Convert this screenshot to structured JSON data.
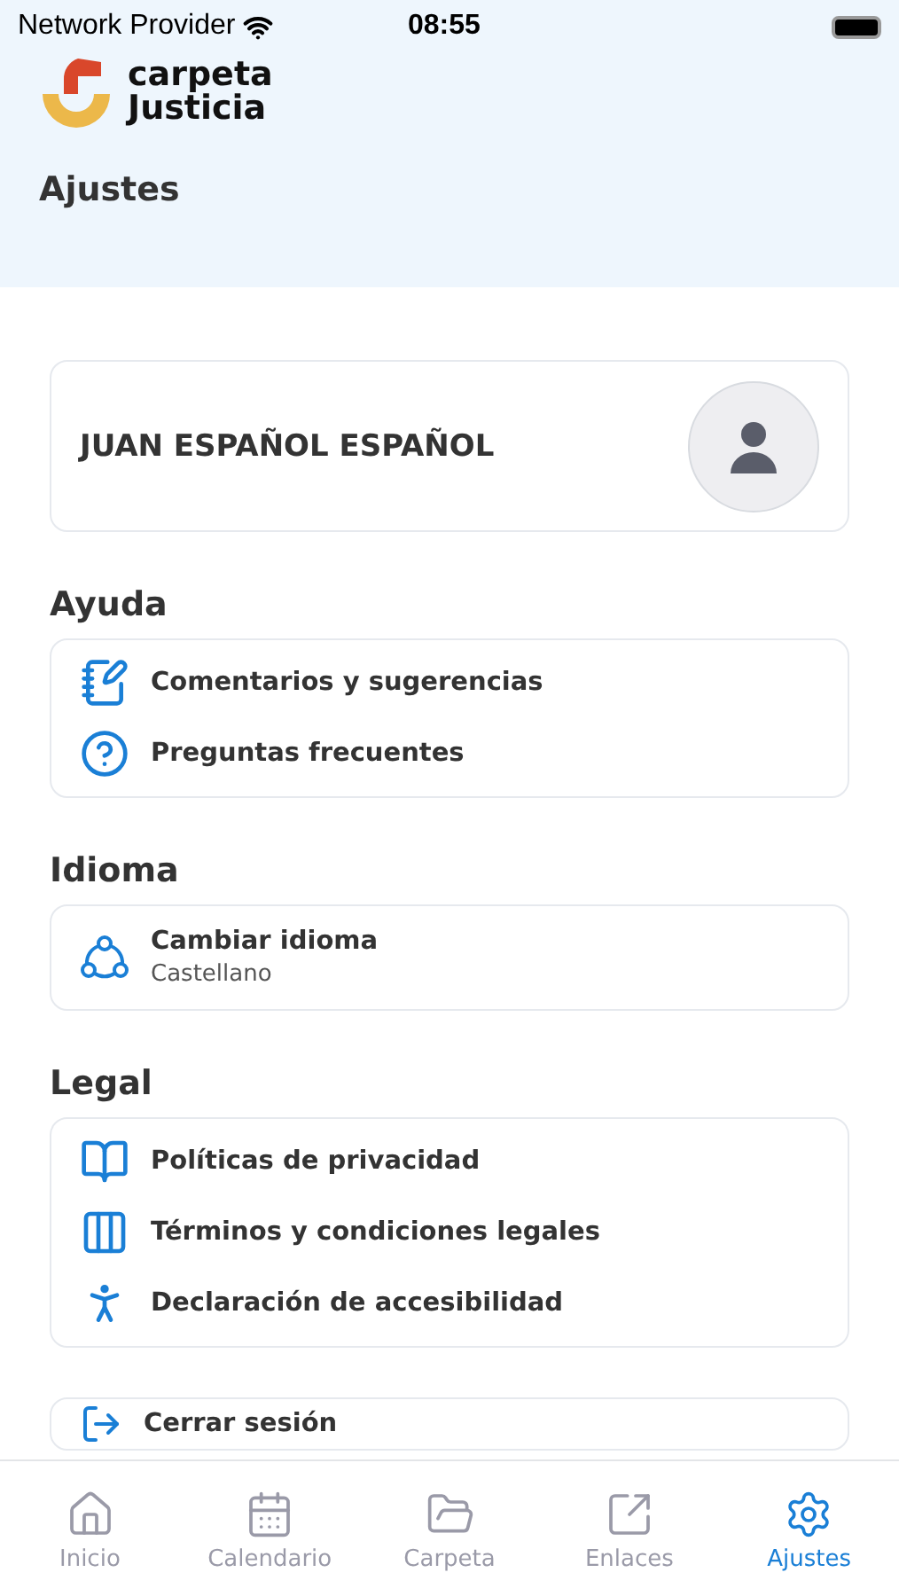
{
  "status_bar": {
    "carrier": "Network Provider",
    "time": "08:55"
  },
  "logo": {
    "line_1": "carpeta",
    "line_2": "Justicia"
  },
  "title": "Ajustes",
  "profile": {
    "name": "JUAN ESPAÑOL ESPAÑOL"
  },
  "sections": [
    {
      "title": "Ayuda",
      "items": [
        {
          "label": "Comentarios y sugerencias"
        },
        {
          "label": "Preguntas frecuentes"
        }
      ]
    },
    {
      "title": "Idioma",
      "items": [
        {
          "label": "Cambiar idioma",
          "value": "Castellano"
        }
      ]
    },
    {
      "title": "Legal",
      "items": [
        {
          "label": "Políticas de privacidad"
        },
        {
          "label": "Términos y condiciones legales"
        },
        {
          "label": "Declaración de accesibilidad"
        }
      ]
    }
  ],
  "logout": {
    "label": "Cerrar sesión"
  },
  "tab_bar": [
    {
      "label": "Inicio",
      "selected": false
    },
    {
      "label": "Calendario",
      "selected": false
    },
    {
      "label": "Carpeta",
      "selected": false
    },
    {
      "label": "Enlaces",
      "selected": false
    },
    {
      "label": "Ajustes",
      "selected": true
    }
  ]
}
